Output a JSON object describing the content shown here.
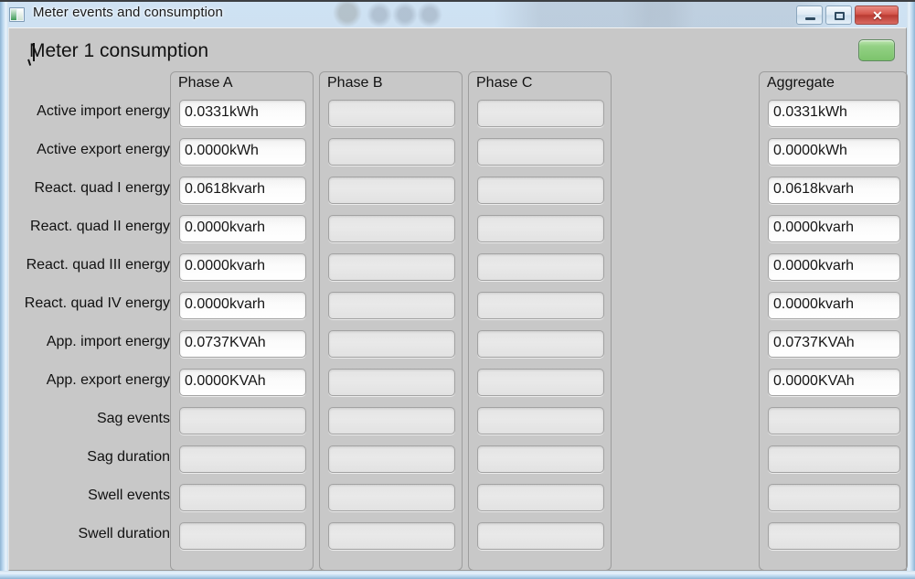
{
  "window": {
    "title": "Meter events and consumption",
    "icon": "app-window-icon",
    "controls": {
      "minimize": "minimize-button",
      "maximize": "maximize-button",
      "close_glyph": "✕"
    }
  },
  "header": {
    "page_title": "Meter 1 consumption",
    "status_indicator_color": "#7cc36c",
    "status_indicator_name": "status-led-green"
  },
  "table": {
    "row_labels": [
      "Active import energy",
      "Active export energy",
      "React. quad I energy",
      "React. quad II energy",
      "React. quad III energy",
      "React. quad IV energy",
      "App. import energy",
      "App. export energy",
      "Sag events",
      "Sag duration",
      "Swell events",
      "Swell duration"
    ],
    "columns": [
      {
        "title": "Phase A",
        "key": "phase_a",
        "values": [
          "0.0331kWh",
          "0.0000kWh",
          "0.0618kvarh",
          "0.0000kvarh",
          "0.0000kvarh",
          "0.0000kvarh",
          "0.0737KVAh",
          "0.0000KVAh",
          "",
          "",
          "",
          ""
        ]
      },
      {
        "title": "Phase B",
        "key": "phase_b",
        "values": [
          "",
          "",
          "",
          "",
          "",
          "",
          "",
          "",
          "",
          "",
          "",
          ""
        ]
      },
      {
        "title": "Phase C",
        "key": "phase_c",
        "values": [
          "",
          "",
          "",
          "",
          "",
          "",
          "",
          "",
          "",
          "",
          "",
          ""
        ]
      },
      {
        "title": "Aggregate",
        "key": "aggregate",
        "values": [
          "0.0331kWh",
          "0.0000kWh",
          "0.0618kvarh",
          "0.0000kvarh",
          "0.0000kvarh",
          "0.0000kvarh",
          "0.0737KVAh",
          "0.0000KVAh",
          "",
          "",
          "",
          ""
        ]
      }
    ]
  }
}
